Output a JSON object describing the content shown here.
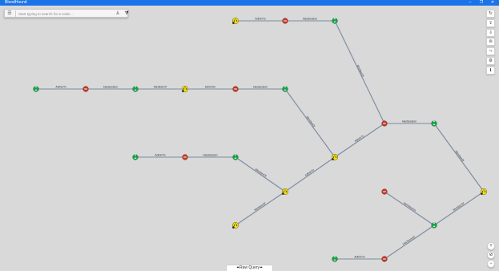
{
  "window": {
    "title": "BloodHound",
    "minimize": "–",
    "maximize": "❐",
    "close": "✕"
  },
  "search": {
    "menu_icon": "☰",
    "placeholder": "Start typing to search for a node...",
    "pathfinding_icon": "⅄",
    "filter_icon": "⧩"
  },
  "toolbar": [
    {
      "name": "refresh-button",
      "icon": "refresh-icon",
      "glyph": "↻"
    },
    {
      "name": "export-graph-button",
      "icon": "export-icon",
      "glyph": "⇪"
    },
    {
      "name": "import-graph-button",
      "icon": "import-icon",
      "glyph": "⇩"
    },
    {
      "name": "upload-data-button",
      "icon": "upload-icon",
      "glyph": "⊚"
    },
    {
      "name": "change-layout-button",
      "icon": "layout-icon",
      "glyph": "⤳"
    },
    {
      "name": "settings-button",
      "icon": "settings-icon",
      "glyph": "⚙"
    },
    {
      "name": "about-button",
      "icon": "info-icon",
      "glyph": "ℹ"
    }
  ],
  "zoom": {
    "zoom_in": "+",
    "reset": "⊘",
    "zoom_out": "−"
  },
  "raw_query": {
    "label": "⏶Raw Query⏶"
  },
  "colors": {
    "user_node": "#16a34a",
    "session_node": "#c0392b",
    "computer_node": "#f7e31a",
    "edge": "#7a8aa0"
  },
  "graph": {
    "nodes": [
      {
        "id": "n1",
        "type": "computer"
      },
      {
        "id": "n2",
        "type": "session"
      },
      {
        "id": "n3",
        "type": "user"
      },
      {
        "id": "n4",
        "type": "user"
      },
      {
        "id": "n5",
        "type": "session"
      },
      {
        "id": "n6",
        "type": "user"
      },
      {
        "id": "n7",
        "type": "computer"
      },
      {
        "id": "n8",
        "type": "session"
      },
      {
        "id": "n9",
        "type": "user"
      },
      {
        "id": "n10",
        "type": "session"
      },
      {
        "id": "n11",
        "type": "user"
      },
      {
        "id": "n12",
        "type": "user"
      },
      {
        "id": "n13",
        "type": "session"
      },
      {
        "id": "n14",
        "type": "user"
      },
      {
        "id": "n15",
        "type": "computer"
      },
      {
        "id": "n16",
        "type": "computer"
      },
      {
        "id": "n17",
        "type": "computer"
      },
      {
        "id": "n18",
        "type": "session"
      },
      {
        "id": "n19",
        "type": "computer"
      },
      {
        "id": "n20",
        "type": "user"
      },
      {
        "id": "n21",
        "type": "user"
      },
      {
        "id": "n22",
        "type": "session"
      }
    ],
    "edges": [
      {
        "from": "n1",
        "to": "n2",
        "label": "AdminTo"
      },
      {
        "from": "n2",
        "to": "n3",
        "label": "HasSession"
      },
      {
        "from": "n4",
        "to": "n5",
        "label": "AdminTo"
      },
      {
        "from": "n5",
        "to": "n6",
        "label": "HasSession"
      },
      {
        "from": "n6",
        "to": "n7",
        "label": "MemberOf"
      },
      {
        "from": "n7",
        "to": "n8",
        "label": "AdminTo"
      },
      {
        "from": "n8",
        "to": "n9",
        "label": "HasSession"
      },
      {
        "from": "n3",
        "to": "n10",
        "label": "MemberOf"
      },
      {
        "from": "n10",
        "to": "n11",
        "label": "HasSession"
      },
      {
        "from": "n9",
        "to": "n15",
        "label": "MemberOf"
      },
      {
        "from": "n15",
        "to": "n10",
        "label": "AdminTo"
      },
      {
        "from": "n12",
        "to": "n13",
        "label": "AdminTo"
      },
      {
        "from": "n13",
        "to": "n14",
        "label": "HasSession"
      },
      {
        "from": "n14",
        "to": "n16",
        "label": "MemberOf"
      },
      {
        "from": "n16",
        "to": "n15",
        "label": "AdminTo"
      },
      {
        "from": "n17",
        "to": "n16",
        "label": "MemberOf"
      },
      {
        "from": "n11",
        "to": "n19",
        "label": "MemberOf"
      },
      {
        "from": "n18",
        "to": "n20",
        "label": "HasSession"
      },
      {
        "from": "n20",
        "to": "n19",
        "label": "MemberOf"
      },
      {
        "from": "n21",
        "to": "n22",
        "label": "AdminTo"
      },
      {
        "from": "n22",
        "to": "n20",
        "label": "HasSession"
      }
    ]
  }
}
